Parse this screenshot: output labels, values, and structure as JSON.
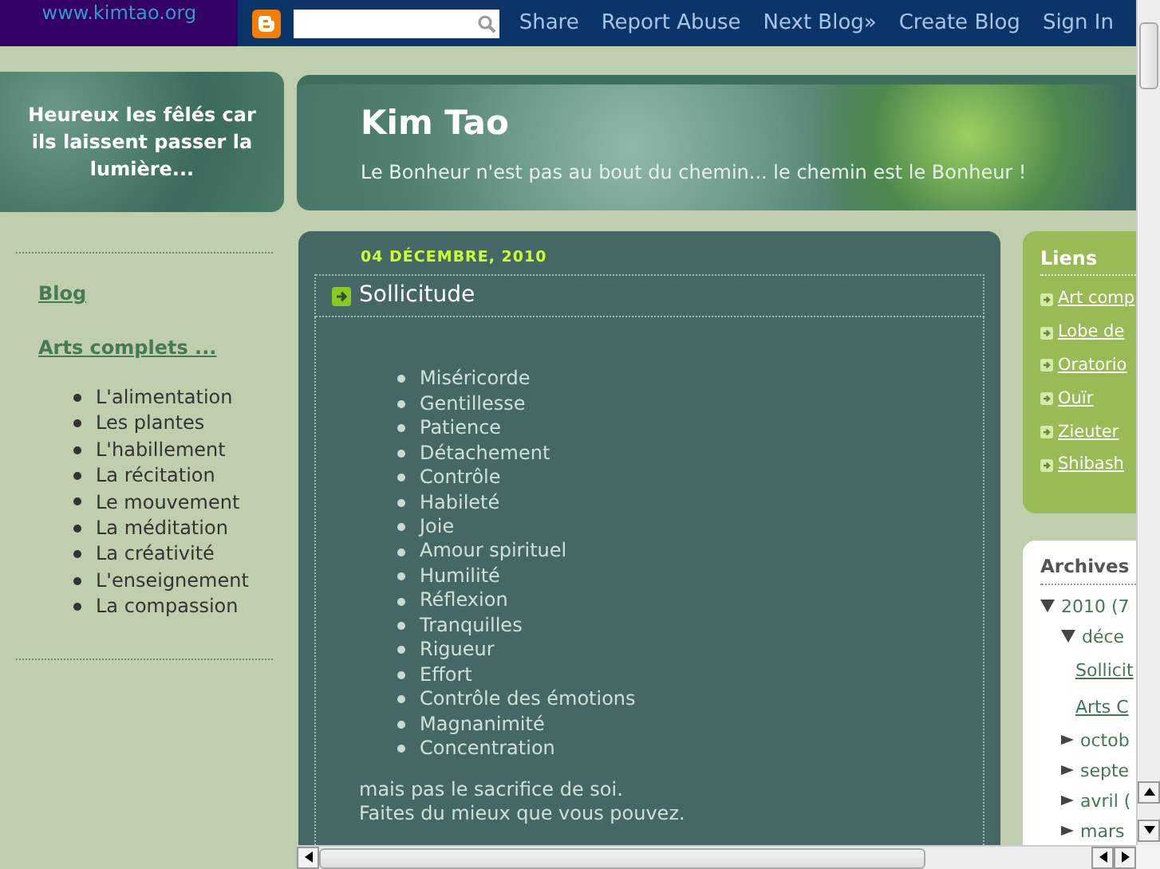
{
  "site_link": "www.kimtao.org",
  "navbar": {
    "links": [
      "Share",
      "Report Abuse",
      "Next Blog»",
      "Create Blog",
      "Sign In"
    ]
  },
  "tagline": "Heureux les fêlés car ils laissent passer la lumière...",
  "header": {
    "title": "Kim Tao",
    "description": "Le Bonheur n'est pas au bout du chemin... le chemin est le Bonheur !"
  },
  "sidebar": {
    "links": [
      "Blog",
      "Arts complets ..."
    ],
    "items": [
      "L'alimentation",
      "Les plantes",
      "L'habillement",
      "La récitation",
      "Le mouvement",
      "La méditation",
      "La créativité",
      "L'enseignement",
      "La compassion"
    ]
  },
  "post": {
    "date": "04 DÉCEMBRE, 2010",
    "title": "Sollicitude",
    "items": [
      "Miséricorde",
      "Gentillesse",
      "Patience",
      "Détachement",
      "Contrôle",
      "Habileté",
      "Joie",
      "Amour spirituel",
      "Humilité",
      "Réflexion",
      "Tranquilles",
      "Rigueur",
      "Effort",
      "Contrôle des émotions",
      "Magnanimité",
      "Concentration"
    ],
    "paragraphs": [
      "mais pas le sacrifice de soi.",
      "Faites du mieux que vous pouvez."
    ]
  },
  "links_box": {
    "title": "Liens",
    "items": [
      "Art comp",
      "Lobe de",
      "Oratorio",
      "Ouïr",
      "Zieuter",
      "Shibash"
    ]
  },
  "archive": {
    "title": "Archives",
    "tree": [
      {
        "kind": "period",
        "label": "2010 (7",
        "expanded": true,
        "children": [
          {
            "kind": "period",
            "label": "déce",
            "expanded": true,
            "children": [
              {
                "kind": "post",
                "label": "Sollicit"
              },
              {
                "kind": "post",
                "label": "Arts C"
              }
            ]
          },
          {
            "kind": "period",
            "label": "octob",
            "expanded": false
          },
          {
            "kind": "period",
            "label": "septe",
            "expanded": false
          },
          {
            "kind": "period",
            "label": "avril (",
            "expanded": false
          },
          {
            "kind": "period",
            "label": "mars",
            "expanded": false
          }
        ]
      }
    ]
  }
}
